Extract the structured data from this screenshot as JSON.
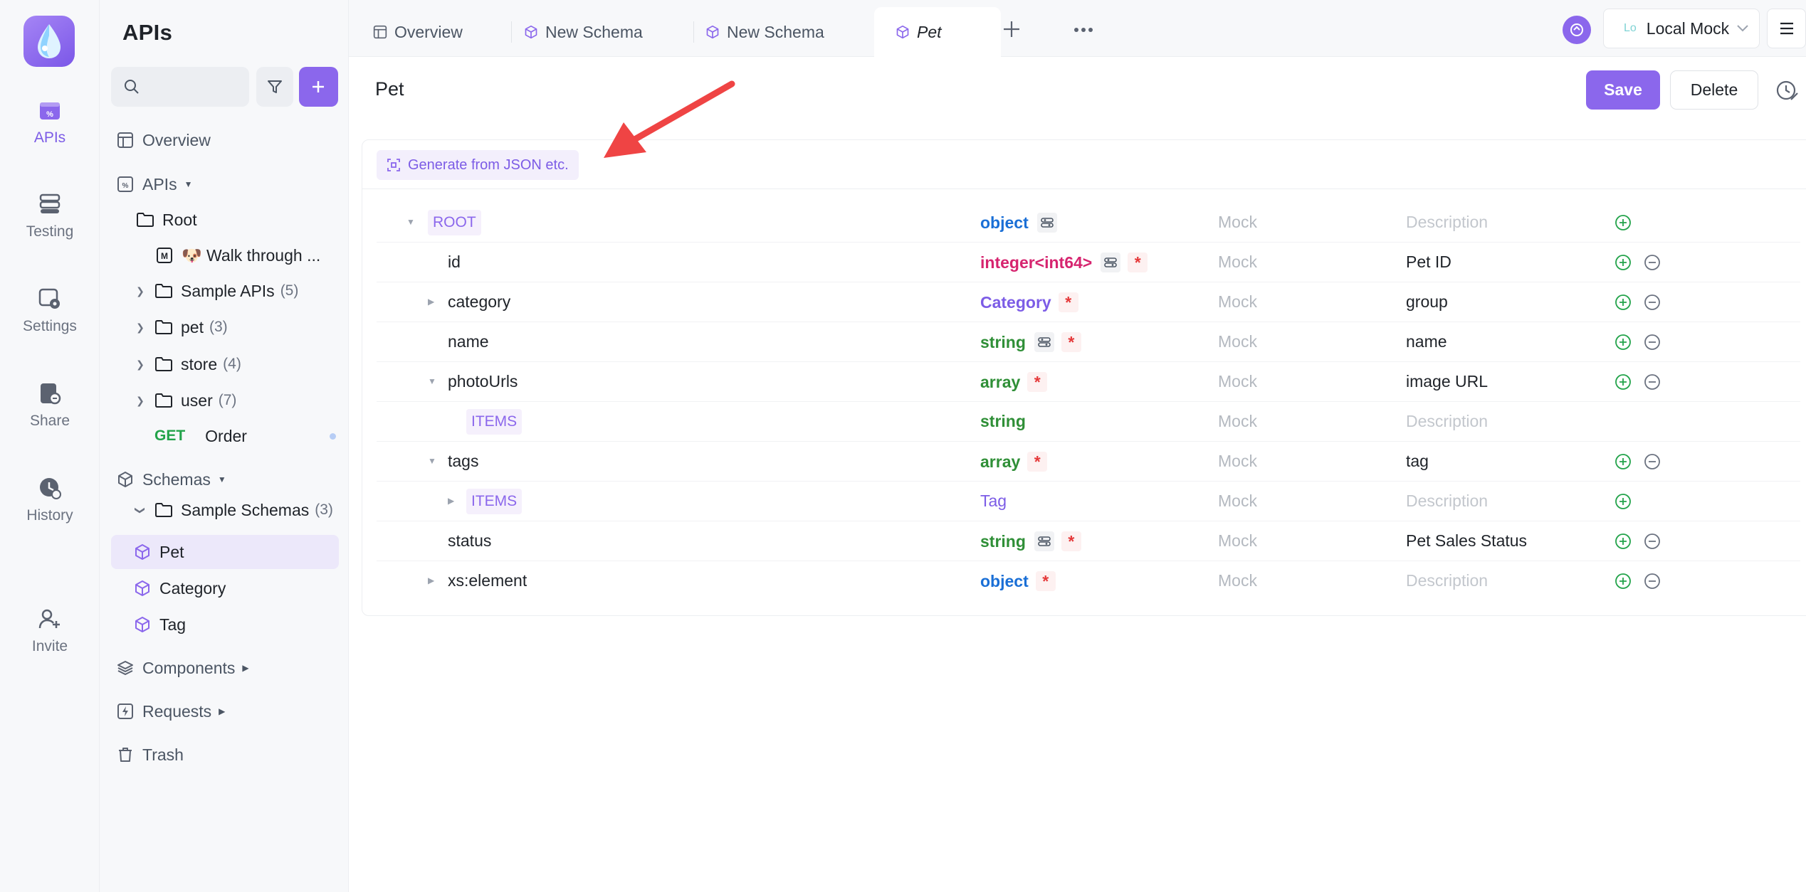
{
  "rail": {
    "items": [
      {
        "label": "APIs",
        "icon": "apis-icon"
      },
      {
        "label": "Testing",
        "icon": "testing-icon"
      },
      {
        "label": "Settings",
        "icon": "settings-icon"
      },
      {
        "label": "Share",
        "icon": "share-icon"
      },
      {
        "label": "History",
        "icon": "history-icon"
      },
      {
        "label": "Invite",
        "icon": "invite-icon"
      }
    ]
  },
  "sidebar": {
    "title": "APIs",
    "search_placeholder": "",
    "tree": {
      "overview": "Overview",
      "apis": "APIs",
      "root": "Root",
      "walkthrough": "🐶 Walk through ...",
      "sample_apis": {
        "label": "Sample APIs",
        "count": "(5)"
      },
      "pet": {
        "label": "pet",
        "count": "(3)"
      },
      "store": {
        "label": "store",
        "count": "(4)"
      },
      "user": {
        "label": "user",
        "count": "(7)"
      },
      "order": {
        "method": "GET",
        "label": "Order"
      },
      "schemas": "Schemas",
      "sample_schemas": {
        "label": "Sample Schemas",
        "count": "(3)"
      },
      "schema_pet": "Pet",
      "schema_category": "Category",
      "schema_tag": "Tag",
      "components": "Components",
      "requests": "Requests",
      "trash": "Trash"
    }
  },
  "tabs": [
    {
      "label": "Overview"
    },
    {
      "label": "New Schema"
    },
    {
      "label": "New Schema"
    },
    {
      "label": "Pet"
    }
  ],
  "env": {
    "abbr": "Lo",
    "label": "Local Mock"
  },
  "main": {
    "title": "Pet",
    "save_label": "Save",
    "delete_label": "Delete",
    "generate_label": "Generate from JSON etc."
  },
  "schema_rows": [
    {
      "name": "ROOT",
      "type": "object",
      "mock": "Mock",
      "desc": "Description"
    },
    {
      "name": "id",
      "type": "integer<int64>",
      "mock": "Mock",
      "desc": "Pet ID"
    },
    {
      "name": "category",
      "type": "Category",
      "mock": "Mock",
      "desc": "group"
    },
    {
      "name": "name",
      "type": "string",
      "mock": "Mock",
      "desc": "name"
    },
    {
      "name": "photoUrls",
      "type": "array",
      "mock": "Mock",
      "desc": "image URL"
    },
    {
      "name": "ITEMS",
      "type": "string",
      "mock": "Mock",
      "desc": "Description"
    },
    {
      "name": "tags",
      "type": "array",
      "mock": "Mock",
      "desc": "tag"
    },
    {
      "name": "ITEMS",
      "type": "Tag",
      "mock": "Mock",
      "desc": "Description"
    },
    {
      "name": "status",
      "type": "string",
      "mock": "Mock",
      "desc": "Pet Sales Status"
    },
    {
      "name": "xs:element",
      "type": "object",
      "mock": "Mock",
      "desc": "Description"
    }
  ],
  "colors": {
    "accent": "#8b67ec",
    "type_object": "#1a6fd6",
    "type_integer": "#d6246f",
    "type_ref": "#7c5ce6",
    "type_string": "#2f8f37",
    "required": "#e5393a",
    "add_green": "#22a34a",
    "annotation_arrow": "#ef4444"
  }
}
